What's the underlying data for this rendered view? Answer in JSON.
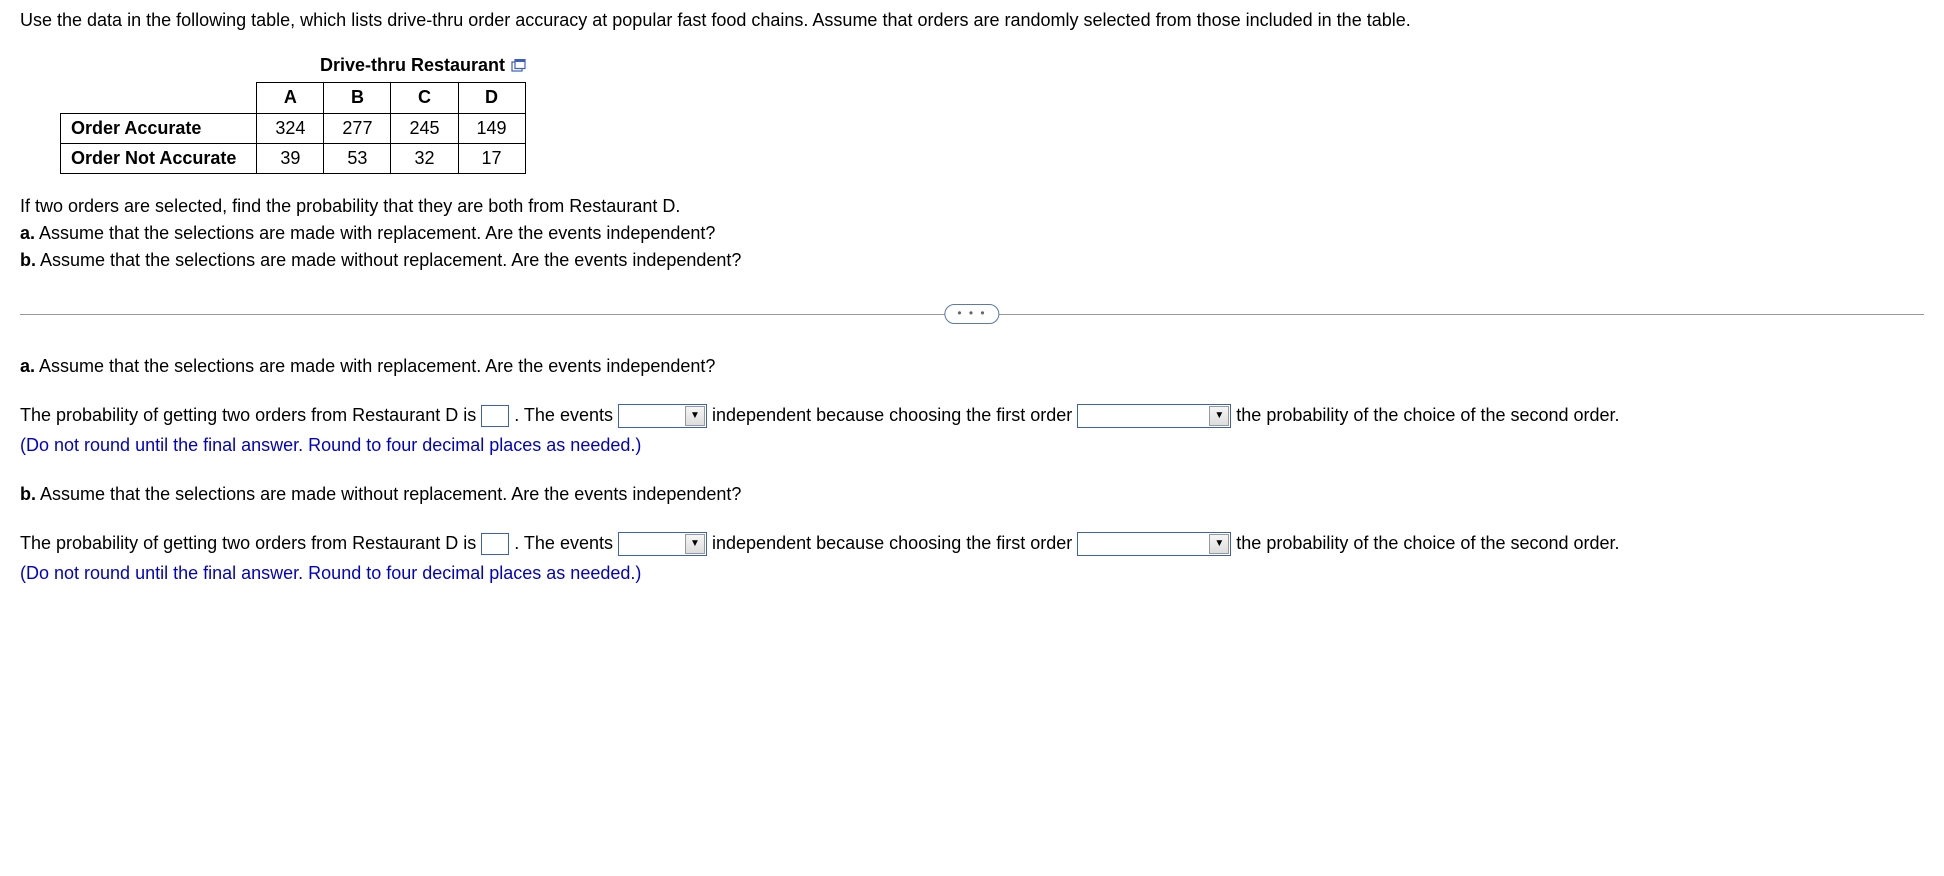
{
  "problem": {
    "intro": "Use the data in the following table, which lists drive-thru order accuracy at popular fast food chains. Assume that orders are randomly selected from those included in the table.",
    "table_title": "Drive-thru Restaurant",
    "columns": [
      "A",
      "B",
      "C",
      "D"
    ],
    "rows": [
      {
        "label": "Order Accurate",
        "values": [
          "324",
          "277",
          "245",
          "149"
        ]
      },
      {
        "label": "Order Not Accurate",
        "values": [
          "39",
          "53",
          "32",
          "17"
        ]
      }
    ],
    "question_main": "If two orders are selected, find the probability that they are both from Restaurant D.",
    "question_a_label": "a.",
    "question_a": "Assume that the selections are made with replacement. Are the events independent?",
    "question_b_label": "b.",
    "question_b": "Assume that the selections are made without replacement. Are the events independent?"
  },
  "divider_dots": "• • •",
  "answers": {
    "a": {
      "label": "a.",
      "prompt": "Assume that the selections are made with replacement. Are the events independent?",
      "sentence_p1": "The probability of getting two orders from Restaurant D is",
      "sentence_p2": ". The events",
      "sentence_p3": "independent because choosing the first order",
      "sentence_p4": "the probability of the choice of the second order.",
      "hint": "(Do not round until the final answer. Round to four decimal places as needed.)"
    },
    "b": {
      "label": "b.",
      "prompt": "Assume that the selections are made without replacement. Are the events independent?",
      "sentence_p1": "The probability of getting two orders from Restaurant D is",
      "sentence_p2": ". The events",
      "sentence_p3": "independent because choosing the first order",
      "sentence_p4": "the probability of the choice of the second order.",
      "hint": "(Do not round until the final answer. Round to four decimal places as needed.)"
    }
  }
}
